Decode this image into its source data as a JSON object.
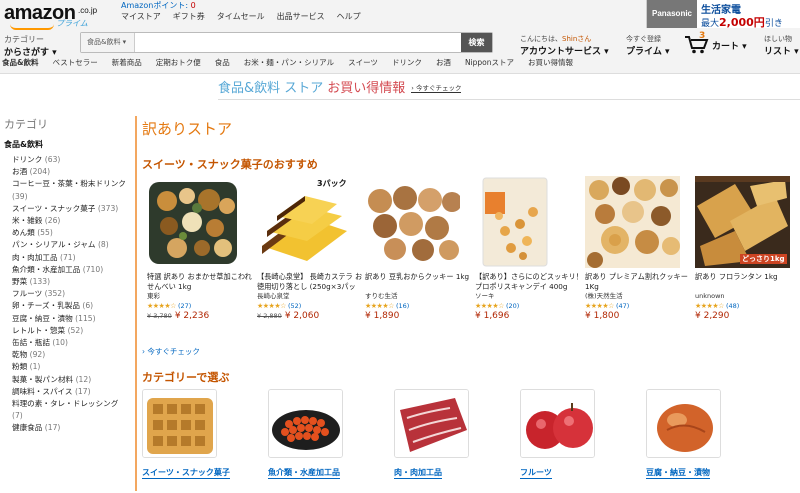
{
  "header": {
    "logo_text": "amazon",
    "logo_domain": ".co.jp",
    "logo_prime": "プライム",
    "points_label": "Amazonポイント:",
    "points_value": "0",
    "top_links": [
      "マイストア",
      "ギフト券",
      "タイムセール",
      "出品サービス",
      "ヘルプ"
    ],
    "promo_brand": "Panasonic",
    "promo_line1": "生活家電",
    "promo_line2_pre": "最大",
    "promo_line2_amount": "2,000円",
    "promo_line2_post": "引き",
    "deliver_small": "カテゴリー",
    "deliver_big": "からさがす ▾",
    "search_category": "食品&飲料 ▾",
    "search_value": "",
    "search_button": "検索",
    "account_small_pre": "こんにちは、",
    "account_name": "Shinさん",
    "account_big": "アカウントサービス ▾",
    "prime_small": "今すぐ登録",
    "prime_big": "プライム ▾",
    "cart_count": "3",
    "cart_label": "カート ▾",
    "wish_small": "ほしい物",
    "wish_big": "リスト ▾"
  },
  "catbar": [
    "食品&飲料",
    "ベストセラー",
    "新着商品",
    "定期おトク便",
    "食品",
    "お米・麺・パン・シリアル",
    "スイーツ",
    "ドリンク",
    "お酒",
    "Nipponストア",
    "お買い得情報"
  ],
  "banner": {
    "part1": "食品&飲料 ストア",
    "part2": "お買い得情報",
    "more": "› 今すぐチェック"
  },
  "sidebar": {
    "heading": "カテゴリ",
    "root": "食品&飲料",
    "items": [
      {
        "label": "ドリンク",
        "count": "(63)"
      },
      {
        "label": "お酒",
        "count": "(204)"
      },
      {
        "label": "コーヒー豆・茶葉・粉末ドリンク",
        "count": "(39)"
      },
      {
        "label": "スイーツ・スナック菓子",
        "count": "(373)"
      },
      {
        "label": "米・雑穀",
        "count": "(26)"
      },
      {
        "label": "めん類",
        "count": "(55)"
      },
      {
        "label": "パン・シリアル・ジャム",
        "count": "(8)"
      },
      {
        "label": "肉・肉加工品",
        "count": "(71)"
      },
      {
        "label": "魚介類・水産加工品",
        "count": "(710)"
      },
      {
        "label": "野菜",
        "count": "(133)"
      },
      {
        "label": "フルーツ",
        "count": "(352)"
      },
      {
        "label": "卵・チーズ・乳製品",
        "count": "(6)"
      },
      {
        "label": "豆腐・納豆・漬物",
        "count": "(115)"
      },
      {
        "label": "レトルト・惣菜",
        "count": "(52)"
      },
      {
        "label": "缶詰・瓶詰",
        "count": "(10)"
      },
      {
        "label": "乾物",
        "count": "(92)"
      },
      {
        "label": "粉類",
        "count": "(1)"
      },
      {
        "label": "製菓・製パン材料",
        "count": "(12)"
      },
      {
        "label": "調味料・スパイス",
        "count": "(17)"
      },
      {
        "label": "料理の素・タレ・ドレッシング",
        "count": "(7)"
      },
      {
        "label": "健康食品",
        "count": "(17)"
      }
    ]
  },
  "main": {
    "title": "訳ありストア",
    "section1": "スイーツ・スナック菓子のおすすめ",
    "products": [
      {
        "title": "特選 訳あり おまかせ草加こわれせんべい 1kg",
        "maker": "東彩",
        "stars": "★★★★☆",
        "reviews": "(27)",
        "old_price": "¥ 3,780",
        "price": "¥ 2,236",
        "rating": 4
      },
      {
        "title": "【長崎心泉堂】 長崎カステラ お徳用切り落とし (250g×3パック)",
        "maker": "長崎心泉堂",
        "stars": "★★★★☆",
        "reviews": "(52)",
        "old_price": "¥ 2,880",
        "price": "¥ 2,060",
        "rating": 4,
        "badge": "3パック"
      },
      {
        "title": "訳あり 豆乳おからクッキー 1kg",
        "maker": "すりむ生活",
        "stars": "★★★★☆",
        "reviews": "(16)",
        "old_price": "",
        "price": "¥ 1,890",
        "rating": 4
      },
      {
        "title": "【訳あり】さらにのどスッキリ！プロポリスキャンデイ 400g",
        "maker": "ソーキ",
        "stars": "★★★★☆",
        "reviews": "(20)",
        "old_price": "",
        "price": "¥ 1,696",
        "rating": 4
      },
      {
        "title": "訳あり プレミアム割れクッキー1Kg",
        "maker": "(株)天然生活",
        "stars": "★★★★☆",
        "reviews": "(47)",
        "old_price": "",
        "price": "¥ 1,800",
        "rating": 3.5
      },
      {
        "title": "訳あり フロランタン 1kg",
        "maker": "unknown",
        "stars": "★★★★☆",
        "reviews": "(48)",
        "old_price": "",
        "price": "¥ 2,290",
        "rating": 4,
        "badge": "どっさり1kg"
      }
    ],
    "now_check": "› 今すぐチェック",
    "section2": "カテゴリーで選ぶ",
    "categories": [
      "スイーツ・スナック菓子",
      "魚介類・水産加工品",
      "肉・肉加工品",
      "フルーツ",
      "豆腐・納豆・漬物"
    ]
  }
}
